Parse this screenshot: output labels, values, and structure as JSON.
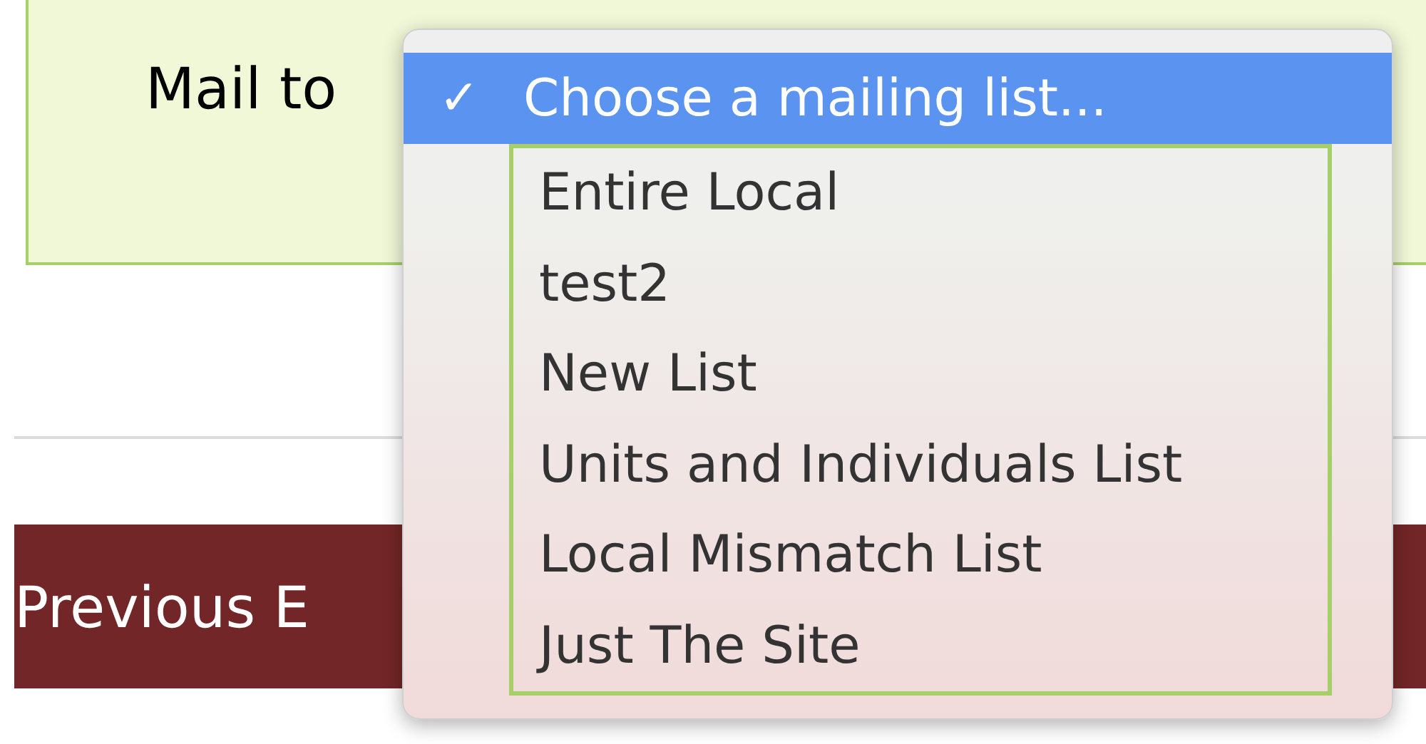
{
  "form": {
    "label": "Mail to"
  },
  "section_bar": {
    "title": "Previous E"
  },
  "dropdown": {
    "items": [
      {
        "label": "Choose a mailing list...",
        "selected": true,
        "check": "✓"
      },
      {
        "label": "Entire Local",
        "selected": false
      },
      {
        "label": "test2",
        "selected": false
      },
      {
        "label": "New List",
        "selected": false
      },
      {
        "label": "Units and Individuals List",
        "selected": false
      },
      {
        "label": "Local Mismatch List",
        "selected": false
      },
      {
        "label": "Just The Site",
        "selected": false
      }
    ]
  }
}
